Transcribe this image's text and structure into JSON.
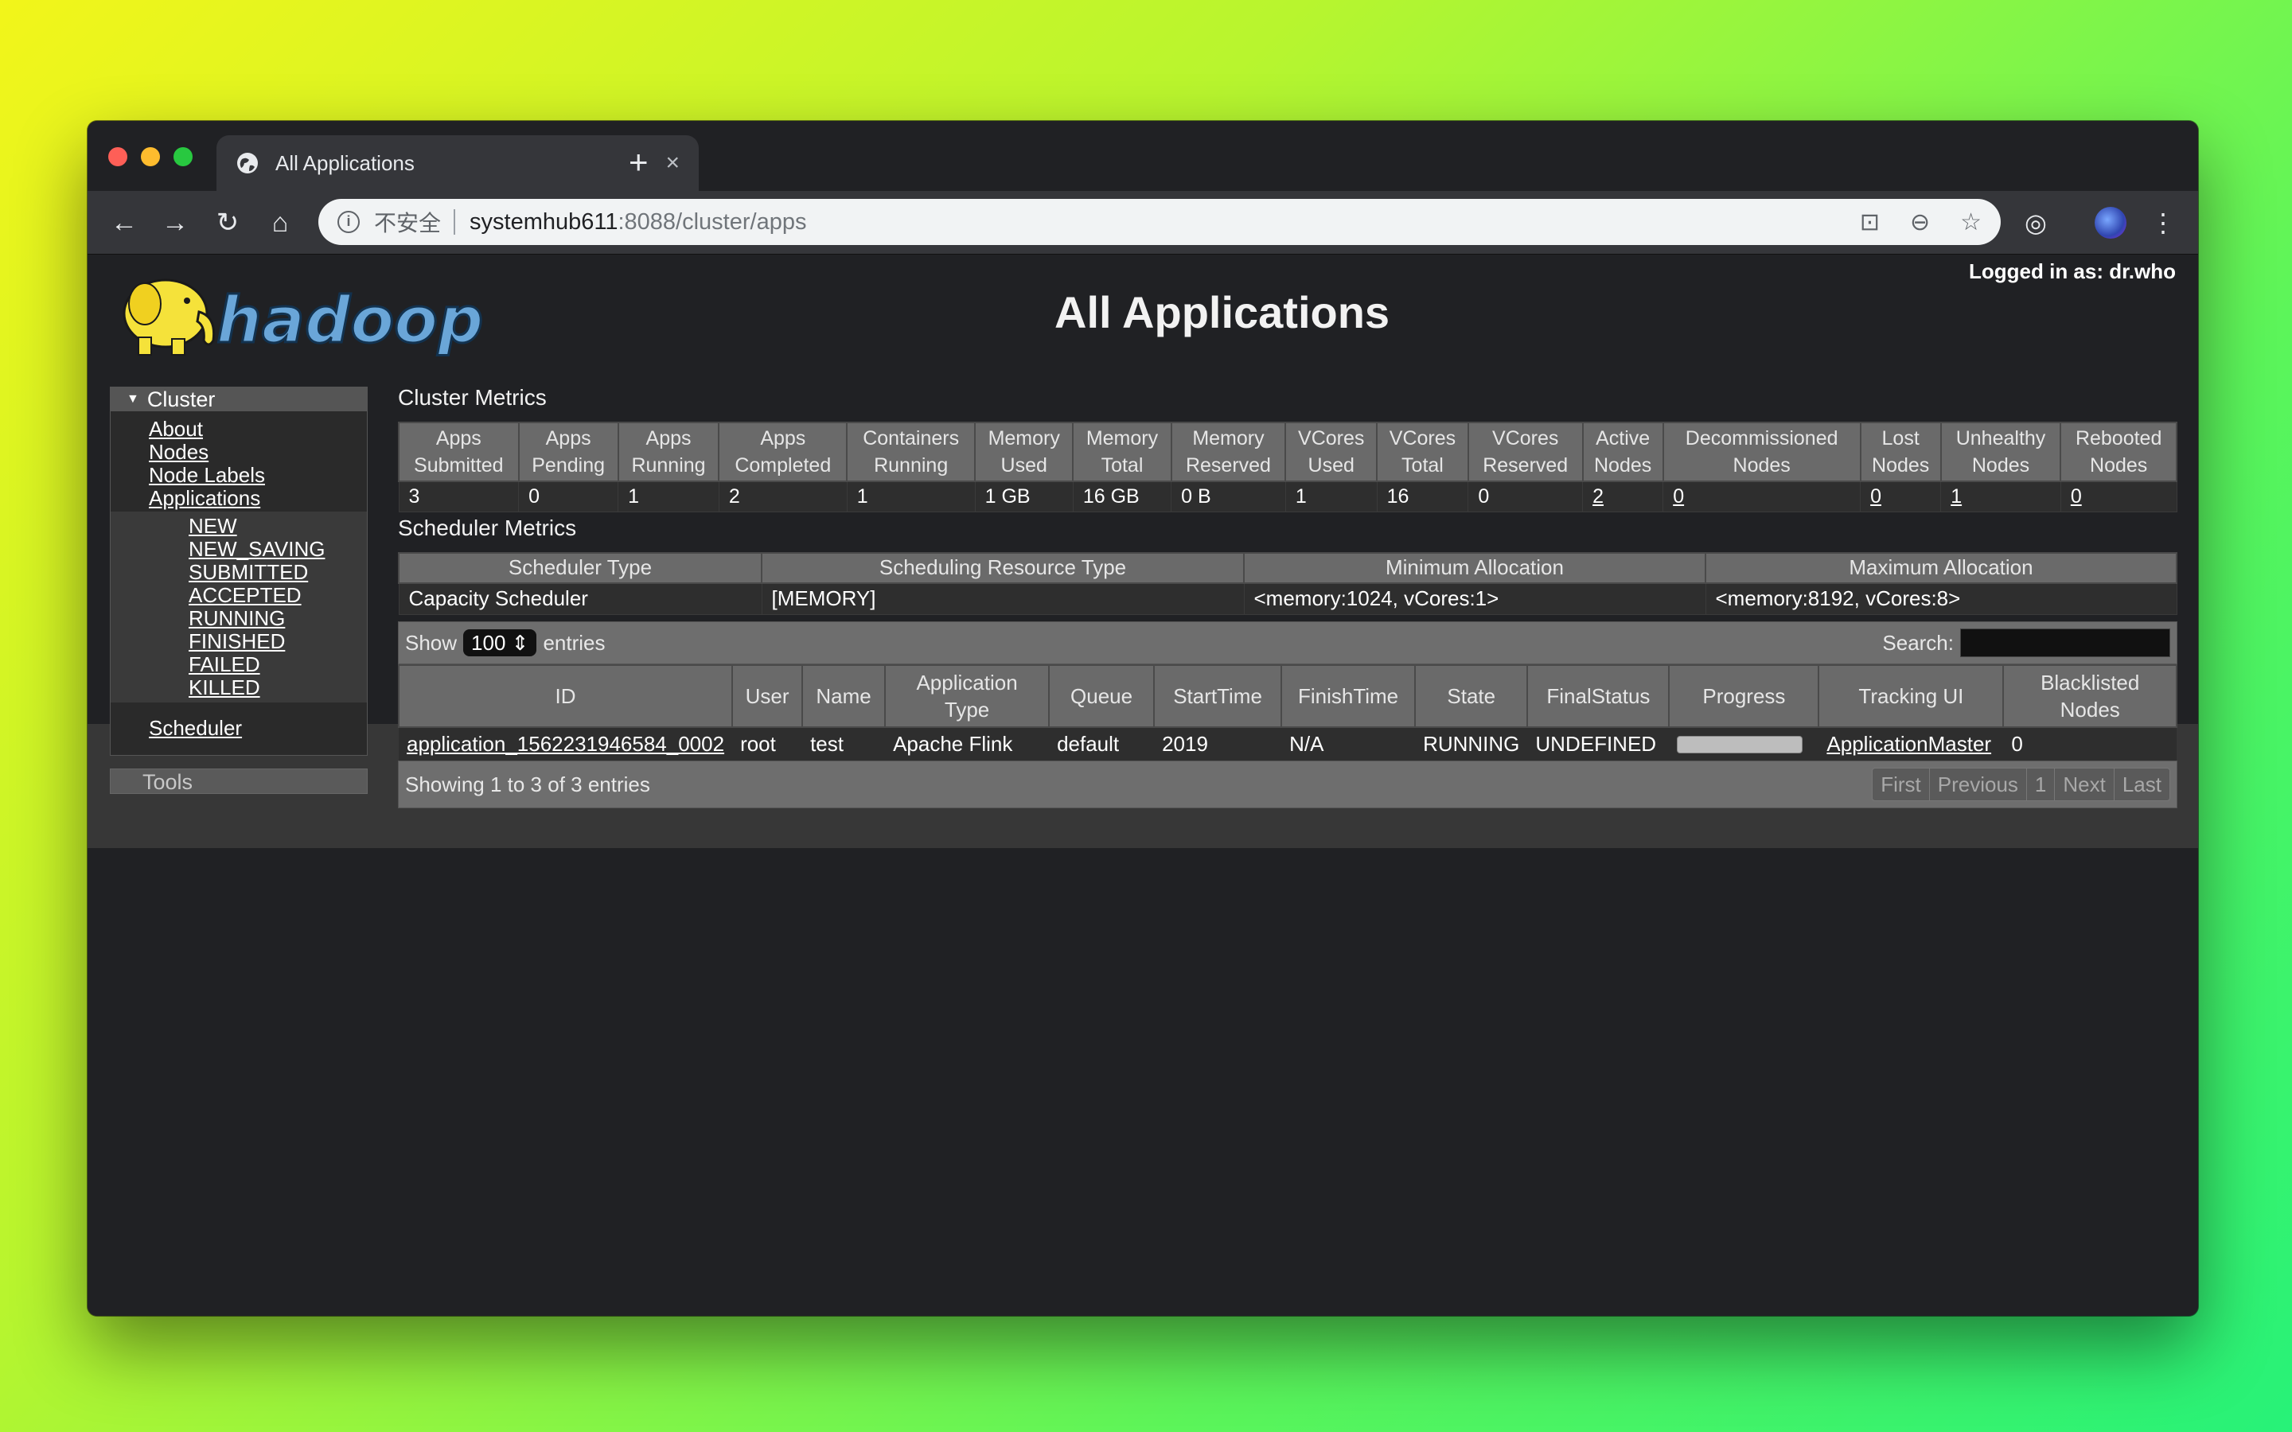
{
  "browser": {
    "tab_title": "All Applications",
    "tab_close": "×",
    "new_tab": "+",
    "url_insecure_label": "不安全",
    "url_host": "systemhub611",
    "url_path": ":8088/cluster/apps"
  },
  "header": {
    "logged_in": "Logged in as: dr.who",
    "title": "All Applications",
    "logo_text": "hadoop"
  },
  "sidebar": {
    "cluster_label": "Cluster",
    "links": [
      "About",
      "Nodes",
      "Node Labels",
      "Applications"
    ],
    "app_states": [
      "NEW",
      "NEW_SAVING",
      "SUBMITTED",
      "ACCEPTED",
      "RUNNING",
      "FINISHED",
      "FAILED",
      "KILLED"
    ],
    "scheduler": "Scheduler",
    "tools_label": "Tools"
  },
  "cluster_metrics": {
    "title": "Cluster Metrics",
    "headers": [
      [
        "Apps",
        "Submitted"
      ],
      [
        "Apps",
        "Pending"
      ],
      [
        "Apps",
        "Running"
      ],
      [
        "Apps",
        "Completed"
      ],
      [
        "Containers",
        "Running"
      ],
      [
        "Memory",
        "Used"
      ],
      [
        "Memory",
        "Total"
      ],
      [
        "Memory",
        "Reserved"
      ],
      [
        "VCores",
        "Used"
      ],
      [
        "VCores",
        "Total"
      ],
      [
        "VCores",
        "Reserved"
      ],
      [
        "Active",
        "Nodes"
      ],
      [
        "Decommissioned",
        "Nodes"
      ],
      [
        "Lost",
        "Nodes"
      ],
      [
        "Unhealthy",
        "Nodes"
      ],
      [
        "Rebooted",
        "Nodes"
      ]
    ],
    "values": [
      "3",
      "0",
      "1",
      "2",
      "1",
      "1 GB",
      "16 GB",
      "0 B",
      "1",
      "16",
      "0",
      "2",
      "0",
      "0",
      "1",
      "0"
    ]
  },
  "scheduler_metrics": {
    "title": "Scheduler Metrics",
    "headers": [
      "Scheduler Type",
      "Scheduling Resource Type",
      "Minimum Allocation",
      "Maximum Allocation"
    ],
    "values": [
      "Capacity Scheduler",
      "[MEMORY]",
      "<memory:1024, vCores:1>",
      "<memory:8192, vCores:8>"
    ]
  },
  "apps_table": {
    "show_label": "Show",
    "show_value": "100",
    "entries_label": "entries",
    "search_label": "Search:",
    "headers": [
      [
        "ID"
      ],
      [
        "User"
      ],
      [
        "Name"
      ],
      [
        "Application",
        "Type"
      ],
      [
        "Queue"
      ],
      [
        "StartTime"
      ],
      [
        "FinishTime"
      ],
      [
        "State"
      ],
      [
        "FinalStatus"
      ],
      [
        "Progress"
      ],
      [
        "Tracking UI"
      ],
      [
        "Blacklisted",
        "Nodes"
      ]
    ],
    "rows": [
      {
        "id": "application_1562231946584_0002",
        "user": "root",
        "name": "test",
        "type": "Apache Flink",
        "queue": "default",
        "start": "2019",
        "finish": "N/A",
        "state": "RUNNING",
        "final_status": "UNDEFINED",
        "progress": 0,
        "tracking": "ApplicationMaster",
        "blacklisted": "0"
      }
    ],
    "info": "Showing 1 to 3 of 3 entries",
    "pager": [
      "First",
      "Previous",
      "1",
      "Next",
      "Last"
    ]
  }
}
